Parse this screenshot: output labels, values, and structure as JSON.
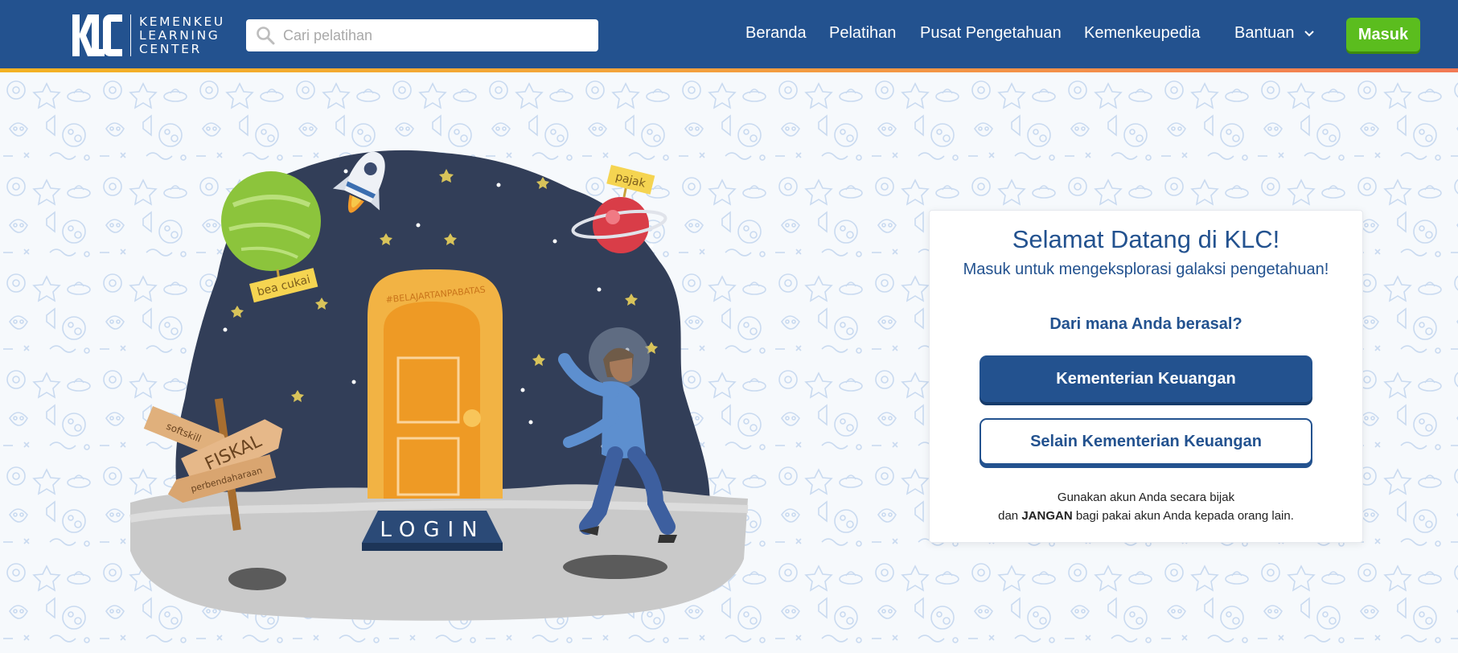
{
  "brand": {
    "logo_text_lines": [
      "KEMENKEU",
      "LEARNING",
      "CENTER"
    ],
    "colors": {
      "primary": "#23528f",
      "accent": "#5bbd1e",
      "stripe": "#f4a53a"
    }
  },
  "search": {
    "placeholder": "Cari pelatihan",
    "value": "",
    "icon": "search-icon"
  },
  "nav": {
    "items": [
      "Beranda",
      "Pelatihan",
      "Pusat Pengetahuan",
      "Kemenkeupedia"
    ],
    "help_label": "Bantuan",
    "help_icon": "chevron-down-icon",
    "login_label": "Masuk"
  },
  "illustration": {
    "door_banner": "#BELAJARTANPABATAS",
    "login_sign": "LOGIN",
    "planet_tag_green": "bea cukai",
    "planet_tag_red": "pajak",
    "signposts": [
      "softskill",
      "FISKAL",
      "perbendaharaan"
    ]
  },
  "card": {
    "title": "Selamat Datang di KLC!",
    "subtitle": "Masuk untuk mengeksplorasi galaksi pengetahuan!",
    "question": "Dari mana Anda berasal?",
    "primary_button": "Kementerian Keuangan",
    "secondary_button": "Selain Kementerian Keuangan",
    "note_line1": "Gunakan akun Anda secara bijak",
    "note_line2_prefix": "dan",
    "note_line2_bold": "JANGAN",
    "note_line2_suffix": "bagi pakai akun Anda kepada orang lain."
  }
}
